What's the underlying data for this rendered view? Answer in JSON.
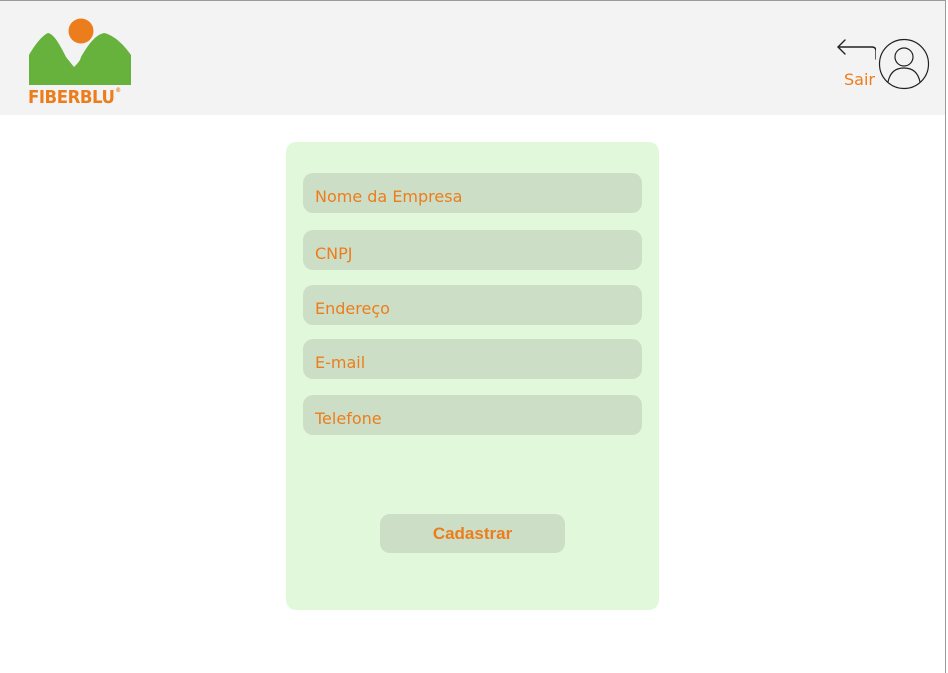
{
  "header": {
    "logo_text": "FIBERBLU",
    "logo_mark": "®",
    "logout_label": "Sair"
  },
  "form": {
    "fields": [
      {
        "placeholder": "Nome da Empresa"
      },
      {
        "placeholder": "CNPJ"
      },
      {
        "placeholder": "Endereço"
      },
      {
        "placeholder": "E-mail"
      },
      {
        "placeholder": "Telefone"
      }
    ],
    "submit_label": "Cadastrar"
  },
  "colors": {
    "accent": "#ec7d1c",
    "logo_green": "#66b23d",
    "card_bg": "#e1f9da",
    "field_bg": "#cddec7",
    "header_bg": "#f3f3f3"
  },
  "icons": [
    "back-arrow-icon",
    "user-icon"
  ]
}
